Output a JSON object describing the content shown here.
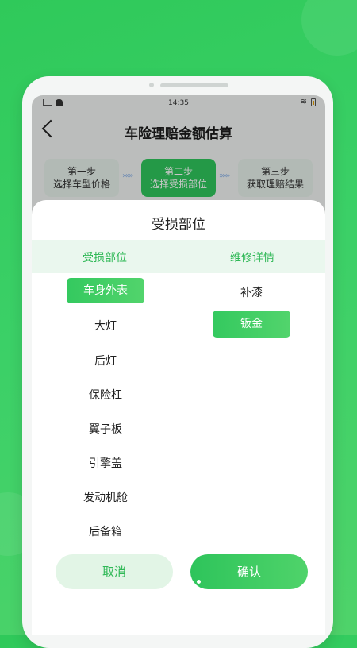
{
  "statusbar": {
    "time": "14:35"
  },
  "header": {
    "title": "车险理赔金额估算"
  },
  "steps": [
    {
      "line1": "第一步",
      "line2": "选择车型价格"
    },
    {
      "line1": "第二步",
      "line2": "选择受损部位"
    },
    {
      "line1": "第三步",
      "line2": "获取理赔结果"
    }
  ],
  "sheet": {
    "title": "受损部位",
    "col1_header": "受损部位",
    "col2_header": "维修详情",
    "parts": [
      "车身外表",
      "大灯",
      "后灯",
      "保险杠",
      "翼子板",
      "引擎盖",
      "发动机舱",
      "后备箱"
    ],
    "repairs": [
      "补漆",
      "钣金"
    ],
    "selected_part": "车身外表",
    "selected_repair": "钣金"
  },
  "buttons": {
    "cancel": "取消",
    "confirm": "确认"
  },
  "colors": {
    "accent": "#2fc45c",
    "light_accent": "#eaf7ee"
  }
}
